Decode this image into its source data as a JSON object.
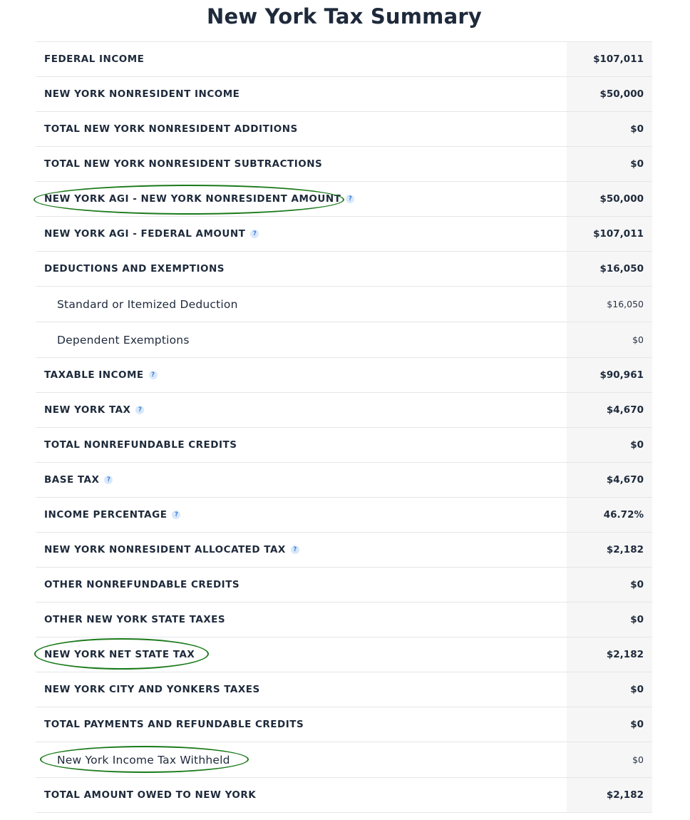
{
  "page": {
    "title": "New York Tax Summary"
  },
  "help_icon": {
    "glyph": "?",
    "icon": "question-circle-icon"
  },
  "annotation_color": "#1a7a1a",
  "rows": [
    {
      "label": "FEDERAL INCOME",
      "value": "$107,011",
      "help": false,
      "sub": false
    },
    {
      "label": "NEW YORK NONRESIDENT INCOME",
      "value": "$50,000",
      "help": false,
      "sub": false
    },
    {
      "label": "TOTAL NEW YORK NONRESIDENT ADDITIONS",
      "value": "$0",
      "help": false,
      "sub": false
    },
    {
      "label": "TOTAL NEW YORK NONRESIDENT SUBTRACTIONS",
      "value": "$0",
      "help": false,
      "sub": false
    },
    {
      "label": "NEW YORK AGI - NEW YORK NONRESIDENT AMOUNT",
      "value": "$50,000",
      "help": true,
      "sub": false,
      "circled": true
    },
    {
      "label": "NEW YORK AGI - FEDERAL AMOUNT",
      "value": "$107,011",
      "help": true,
      "sub": false
    },
    {
      "label": "DEDUCTIONS AND EXEMPTIONS",
      "value": "$16,050",
      "help": false,
      "sub": false
    },
    {
      "label": "Standard or Itemized Deduction",
      "value": "$16,050",
      "help": false,
      "sub": true
    },
    {
      "label": "Dependent Exemptions",
      "value": "$0",
      "help": false,
      "sub": true
    },
    {
      "label": "TAXABLE INCOME",
      "value": "$90,961",
      "help": true,
      "sub": false
    },
    {
      "label": "NEW YORK TAX",
      "value": "$4,670",
      "help": true,
      "sub": false
    },
    {
      "label": "TOTAL NONREFUNDABLE CREDITS",
      "value": "$0",
      "help": false,
      "sub": false
    },
    {
      "label": "BASE TAX",
      "value": "$4,670",
      "help": true,
      "sub": false
    },
    {
      "label": "INCOME PERCENTAGE",
      "value": "46.72%",
      "help": true,
      "sub": false
    },
    {
      "label": "NEW YORK NONRESIDENT ALLOCATED TAX",
      "value": "$2,182",
      "help": true,
      "sub": false
    },
    {
      "label": "OTHER NONREFUNDABLE CREDITS",
      "value": "$0",
      "help": false,
      "sub": false
    },
    {
      "label": "OTHER NEW YORK STATE TAXES",
      "value": "$0",
      "help": false,
      "sub": false
    },
    {
      "label": "NEW YORK NET STATE TAX",
      "value": "$2,182",
      "help": false,
      "sub": false,
      "circled": true
    },
    {
      "label": "NEW YORK CITY AND YONKERS TAXES",
      "value": "$0",
      "help": false,
      "sub": false
    },
    {
      "label": "TOTAL PAYMENTS AND REFUNDABLE CREDITS",
      "value": "$0",
      "help": false,
      "sub": false
    },
    {
      "label": "New York Income Tax Withheld",
      "value": "$0",
      "help": false,
      "sub": true,
      "circled": true
    },
    {
      "label": "TOTAL AMOUNT OWED TO NEW YORK",
      "value": "$2,182",
      "help": false,
      "sub": false
    }
  ]
}
